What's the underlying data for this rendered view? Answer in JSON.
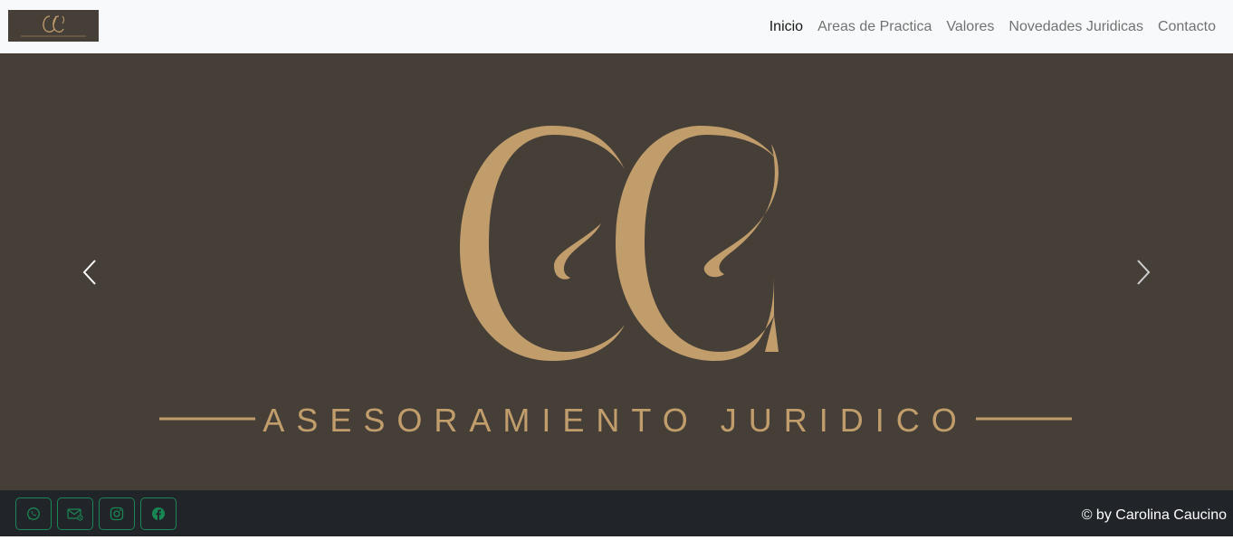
{
  "brand": {
    "logo_icon": "cc-monogram-logo"
  },
  "nav": {
    "items": [
      {
        "label": "Inicio",
        "active": true
      },
      {
        "label": "Areas de Practica",
        "active": false
      },
      {
        "label": "Valores",
        "active": false
      },
      {
        "label": "Novedades Juridicas",
        "active": false
      },
      {
        "label": "Contacto",
        "active": false
      }
    ]
  },
  "hero": {
    "tagline": "ASESORAMIENTO JURIDICO",
    "monogram_icon": "cc-monogram-logo",
    "background_color": "#463f38",
    "gold_color": "#c19d6c"
  },
  "carousel": {
    "prev_icon": "chevron-left-icon",
    "next_icon": "chevron-right-icon"
  },
  "footer": {
    "social": [
      {
        "icon": "whatsapp-icon"
      },
      {
        "icon": "email-icon"
      },
      {
        "icon": "instagram-icon"
      },
      {
        "icon": "facebook-icon"
      }
    ],
    "copyright": "© by Carolina Caucino",
    "accent_color": "#198754"
  }
}
